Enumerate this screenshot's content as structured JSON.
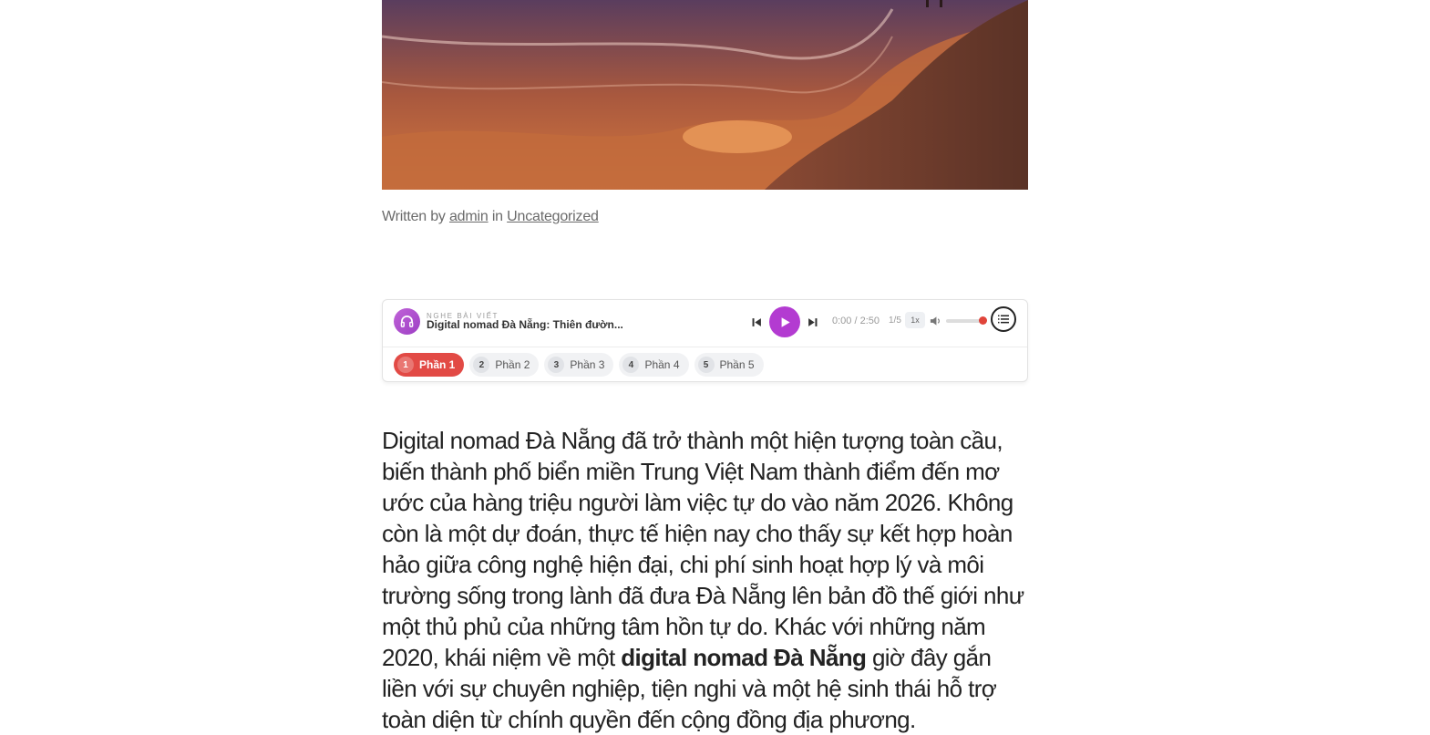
{
  "byline": {
    "prefix": "Written by",
    "author": "admin",
    "middle": "in",
    "category": "Uncategorized"
  },
  "player": {
    "label": "NGHE BÀI VIẾT",
    "title": "Digital nomad Đà Nẵng: Thiên đườn...",
    "time": "0:00 / 2:50",
    "count": "1/5",
    "speed": "1x",
    "volume": 1.0,
    "accent_color": "#b33bd1",
    "chips": [
      {
        "num": "1",
        "label": "Phần 1",
        "active": true
      },
      {
        "num": "2",
        "label": "Phần 2",
        "active": false
      },
      {
        "num": "3",
        "label": "Phần 3",
        "active": false
      },
      {
        "num": "4",
        "label": "Phần 4",
        "active": false
      },
      {
        "num": "5",
        "label": "Phần 5",
        "active": false
      }
    ],
    "icons": [
      "headphones-icon",
      "previous-icon",
      "play-icon",
      "next-icon",
      "volume-icon",
      "playlist-icon"
    ]
  },
  "article": {
    "part1": "Digital nomad Đà Nẵng đã trở thành một hiện tượng toàn cầu, biến thành phố biển miền Trung Việt Nam thành điểm đến mơ ước của hàng triệu người làm việc tự do vào năm 2026. Không còn là một dự đoán, thực tế hiện nay cho thấy sự kết hợp hoàn hảo giữa công nghệ hiện đại, chi phí sinh hoạt hợp lý và môi trường sống trong lành đã đưa Đà Nẵng lên bản đồ thế giới như một thủ phủ của những tâm hồn tự do. Khác với những năm 2020, khái niệm về một ",
    "bold": "digital nomad Đà Nẵng",
    "part2": " giờ đây gắn liền với sự chuyên nghiệp, tiện nghi và một hệ sinh thái hỗ trợ toàn diện từ chính quyền đến cộng đồng địa phương."
  }
}
